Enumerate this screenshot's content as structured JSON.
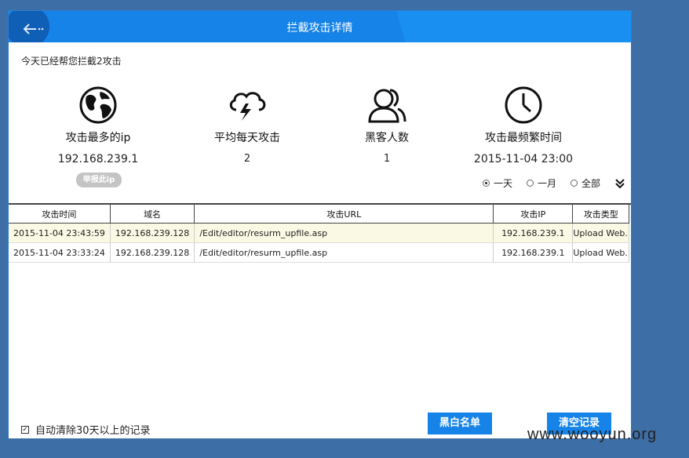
{
  "window": {
    "title": "拦截攻击详情"
  },
  "summary": {
    "text": "今天已经帮您拦截2攻击"
  },
  "stats": [
    {
      "icon": "globe-icon",
      "label": "攻击最多的ip",
      "value": "192.168.239.1"
    },
    {
      "icon": "storm-cloud-icon",
      "label": "平均每天攻击",
      "value": "2"
    },
    {
      "icon": "users-icon",
      "label": "黑客人数",
      "value": "1"
    },
    {
      "icon": "clock-icon",
      "label": "攻击最频繁时间",
      "value": "2015-11-04 23:00"
    }
  ],
  "report_button": "举报此ip",
  "filters": [
    {
      "label": "一天",
      "checked": true
    },
    {
      "label": "一月",
      "checked": false
    },
    {
      "label": "全部",
      "checked": false
    }
  ],
  "table": {
    "headers": [
      "攻击时间",
      "域名",
      "攻击URL",
      "攻击IP",
      "攻击类型"
    ],
    "rows": [
      [
        "2015-11-04 23:43:59",
        "192.168.239.128",
        "/Edit/editor/resurm_upfile.asp",
        "192.168.239.1",
        "Upload Web..."
      ],
      [
        "2015-11-04 23:33:24",
        "192.168.239.128",
        "/Edit/editor/resurm_upfile.asp",
        "192.168.239.1",
        "Upload Web..."
      ]
    ]
  },
  "footer": {
    "auto_clear_label": "自动清除30天以上的记录",
    "auto_clear_checked": true,
    "blacklist_button": "黑白名单",
    "clear_button": "清空记录"
  },
  "watermark": "www.wooyun.org",
  "colors": {
    "accent": "#1683e8",
    "row_highlight": "#fafae4"
  }
}
